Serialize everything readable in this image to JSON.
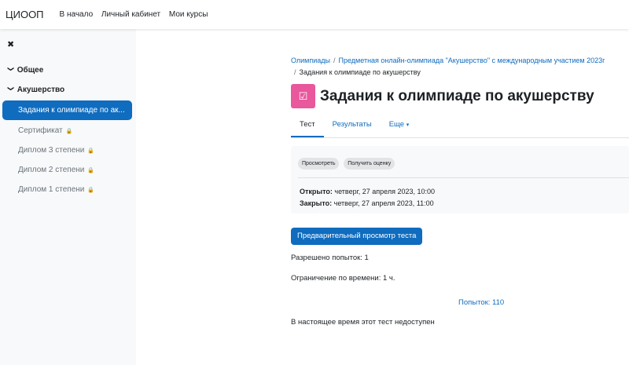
{
  "header": {
    "brand": "ЦИООП",
    "nav": [
      "В начало",
      "Личный кабинет",
      "Мои курсы"
    ]
  },
  "sidebar": {
    "close_icon": "close-icon",
    "sections": [
      "Общее",
      "Акушерство"
    ],
    "items": [
      {
        "label": "Задания к олимпиаде по ак..."
      },
      {
        "label": "Сертификат"
      },
      {
        "label": "Диплом 3 степени"
      },
      {
        "label": "Диплом 2 степени"
      },
      {
        "label": "Диплом 1 степени"
      }
    ]
  },
  "breadcrumb": [
    "Олимпиады",
    "Предметная онлайн-олимпиада \"Акушерство\" с международным участием 2023г",
    "Задания к олимпиаде по акушерству"
  ],
  "page": {
    "title": "Задания к олимпиаде по акушерству",
    "icon_color": "#e9579c"
  },
  "tabs": [
    "Тест",
    "Результаты",
    "Еще"
  ],
  "activity": {
    "buttons": [
      "Просмотреть",
      "Получить оценку"
    ],
    "opened_label": "Открыто:",
    "opened_value": " четверг, 27 апреля 2023, 10:00",
    "closed_label": "Закрыто:",
    "closed_value": " четверг, 27 апреля 2023, 11:00"
  },
  "preview_button": "Предварительный просмотр теста",
  "attempts_allowed": "Разрешено попыток: 1",
  "time_limit": "Ограничение по времени: 1 ч.",
  "attempts_link": "Попыток: 110",
  "unavailable": "В настоящее время этот тест недоступен"
}
